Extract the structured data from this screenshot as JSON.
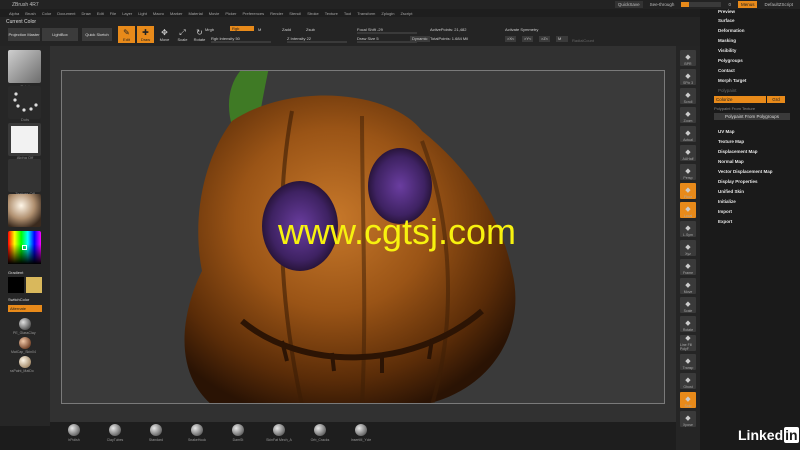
{
  "app": {
    "title": "ZBrush 4R7",
    "quicksave": "QuickSave",
    "see_through": "See-through",
    "see_through_value": "0",
    "menus_button": "Menus",
    "script_name": "DefaultZScript"
  },
  "menubar": [
    "Alpha",
    "Brush",
    "Color",
    "Document",
    "Draw",
    "Edit",
    "File",
    "Layer",
    "Light",
    "Macro",
    "Marker",
    "Material",
    "Movie",
    "Picker",
    "Preferences",
    "Render",
    "Stencil",
    "Stroke",
    "Texture",
    "Tool",
    "Transform",
    "Zplugin",
    "Zscript"
  ],
  "toolbar": {
    "current_color": "Current Color",
    "projection_master": "Projection Master",
    "lightbox": "LightBox",
    "quick_sketch": "Quick Sketch",
    "edit": "Edit",
    "draw": "Draw",
    "move": "Move",
    "scale": "Scale",
    "rotate": "Rotate",
    "mrgb": "Mrgb",
    "rgb": "Rgb",
    "m": "M",
    "rgb_intensity": "Rgb Intensity 50",
    "zadd": "Zadd",
    "zsub": "Zsub",
    "z_intensity": "Z Intensity 22",
    "focal_shift": "Focal Shift -29",
    "draw_size": "Draw Size 5",
    "dynamic": "Dynamic",
    "active_points": "ActivePoints: 21,482",
    "total_points": "TotalPoints: 1.684 Mil",
    "activate_symmetry": "Activate Symmetry",
    "radial_count": "RadialCount"
  },
  "left_shelf": {
    "brush_label": "Paint",
    "stroke_label": "Dots",
    "alpha_label": "Alpha Off",
    "texture_label": "Texture Off",
    "material_label": "",
    "gradient": "Gradient",
    "switch_color": "SwitchColor",
    "alternate": "Alternate",
    "materials": [
      "PE_GlassClay",
      "MatCap_Skin04",
      "ssPaint_MatDo"
    ]
  },
  "bottom_shelf": {
    "brushes": [
      "hPolish",
      "ClayTubes",
      "Standard",
      "SnakeHook",
      "DamSt",
      "SkinFat Mech_A",
      "Orb_Cracks",
      "InsertM_Ycle"
    ]
  },
  "right_shelf": {
    "buttons": [
      "BPR",
      "SPix 3",
      "Scroll",
      "Zoom",
      "Actual",
      "AAHalf",
      "Persp",
      "Floor",
      "Local",
      "L.Sym",
      "Xyz",
      "Frame",
      "Move",
      "Scale",
      "Rotate",
      "Line Fill PolyF",
      "Transp",
      "Ghost",
      "Solo",
      "Xpose"
    ]
  },
  "palette": {
    "items": [
      "Preview",
      "Surface",
      "Deformation",
      "Masking",
      "Visibility",
      "Polygroups",
      "Contact",
      "Morph Target",
      "Polypaint",
      "UV Map",
      "Texture Map",
      "Displacement Map",
      "Normal Map",
      "Vector Displacement Map",
      "Display Properties",
      "Unified Skin",
      "Initialize",
      "Import",
      "Export"
    ],
    "colorize": "Colorize",
    "grd": "Grd",
    "polypaint_from_texture": "Polypaint From Texture",
    "polypaint_from_polygroups": "Polypaint From Polygroups"
  },
  "watermark": "www.cgtsj.com",
  "linkedin": {
    "text": "Linked",
    "box": "in"
  },
  "colors": {
    "accent": "#e88a1a",
    "watermark": "#f7f20f"
  }
}
